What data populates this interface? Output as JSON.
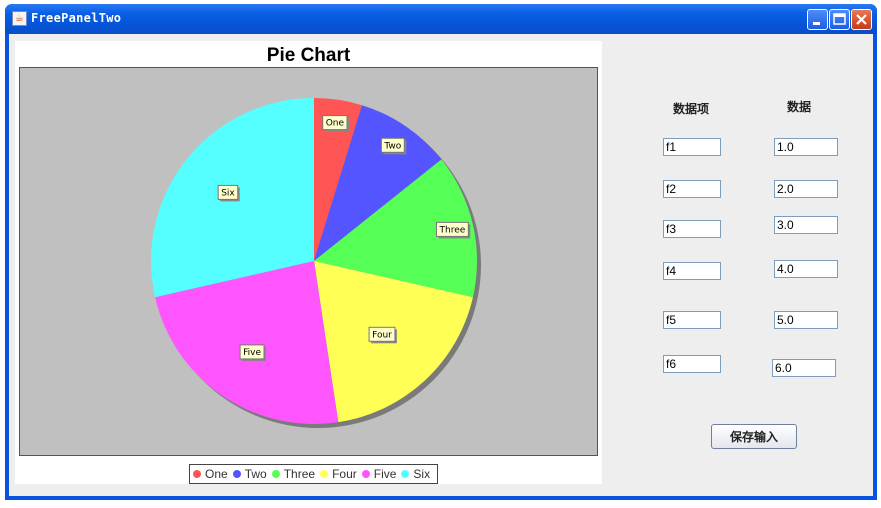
{
  "window": {
    "title": "FreePanelTwo"
  },
  "chart_data": {
    "type": "pie",
    "title": "Pie Chart",
    "categories": [
      "One",
      "Two",
      "Three",
      "Four",
      "Five",
      "Six"
    ],
    "values": [
      1.0,
      2.0,
      3.0,
      4.0,
      5.0,
      6.0
    ],
    "colors": [
      "#ff5555",
      "#5555ff",
      "#55ff55",
      "#ffff55",
      "#ff55ff",
      "#55ffff"
    ],
    "plot_background": "#c0c0c0",
    "start": "12 o'clock",
    "direction": "clockwise",
    "legend": "bottom"
  },
  "form": {
    "item_header": "数据项",
    "value_header": "数据",
    "item_fields": [
      "f1",
      "f2",
      "f3",
      "f4",
      "f5",
      "f6"
    ],
    "value_fields": [
      "1.0",
      "2.0",
      "3.0",
      "4.0",
      "5.0",
      "6.0"
    ],
    "save_label": "保存输入"
  }
}
